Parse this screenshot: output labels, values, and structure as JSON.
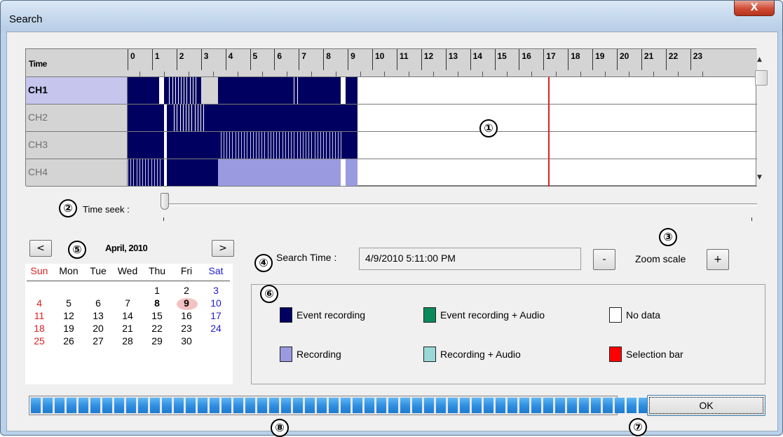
{
  "window": {
    "title": "Search",
    "close_label": "X"
  },
  "timeline": {
    "header_label": "Time",
    "hours": [
      "0",
      "1",
      "2",
      "3",
      "4",
      "5",
      "6",
      "7",
      "8",
      "9",
      "10",
      "11",
      "12",
      "13",
      "14",
      "15",
      "16",
      "17",
      "18",
      "19",
      "20",
      "21",
      "22",
      "23"
    ],
    "channels": [
      {
        "label": "CH1",
        "selected": true
      },
      {
        "label": "CH2",
        "selected": false
      },
      {
        "label": "CH3",
        "selected": false
      },
      {
        "label": "CH4",
        "selected": false
      }
    ],
    "selection_hour": 17.2
  },
  "seek": {
    "label": "Time seek :",
    "value_percent": 0
  },
  "calendar": {
    "prev_label": "<",
    "next_label": ">",
    "month_label": "April, 2010",
    "weekdays": [
      "Sun",
      "Mon",
      "Tue",
      "Wed",
      "Thu",
      "Fri",
      "Sat"
    ],
    "weeks": [
      [
        "",
        "",
        "",
        "",
        "1",
        "2",
        "3"
      ],
      [
        "4",
        "5",
        "6",
        "7",
        "8",
        "9",
        "10"
      ],
      [
        "11",
        "12",
        "13",
        "14",
        "15",
        "16",
        "17"
      ],
      [
        "18",
        "19",
        "20",
        "21",
        "22",
        "23",
        "24"
      ],
      [
        "25",
        "26",
        "27",
        "28",
        "29",
        "30",
        ""
      ]
    ],
    "bold_days": [
      "8",
      "9"
    ],
    "selected_day": "9",
    "colors": {
      "sun": "#e02020",
      "sat": "#2020d0"
    }
  },
  "search": {
    "label": "Search Time :",
    "value": "4/9/2010 5:11:00 PM",
    "zoom_label": "Zoom scale",
    "minus_label": "-",
    "plus_label": "+"
  },
  "legend": {
    "items": [
      {
        "label": "Event recording",
        "color": "#000060"
      },
      {
        "label": "Event recording + Audio",
        "color": "#0a8a5a"
      },
      {
        "label": "No data",
        "color": "#ffffff"
      },
      {
        "label": "Recording",
        "color": "#9a9ae0"
      },
      {
        "label": "Recording + Audio",
        "color": "#9ad8d8"
      },
      {
        "label": "Selection bar",
        "color": "#ff0000"
      }
    ]
  },
  "progress": {
    "blocks": 53,
    "value_percent": 100
  },
  "ok_label": "OK",
  "callouts": [
    "①",
    "②",
    "③",
    "④",
    "⑤",
    "⑥",
    "⑦",
    "⑧"
  ]
}
